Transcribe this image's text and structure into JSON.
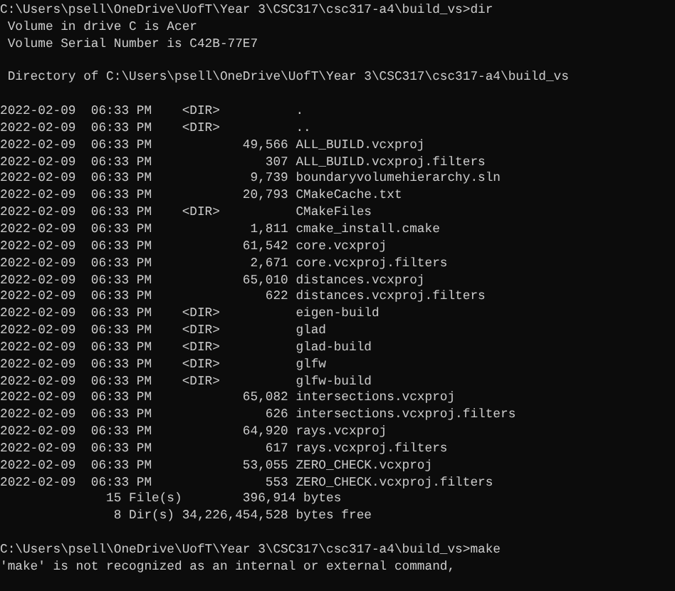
{
  "prompt_dir": "C:\\Users\\psell\\OneDrive\\UofT\\Year 3\\CSC317\\csc317-a4\\build_vs>dir",
  "volume_info": [
    " Volume in drive C is Acer",
    " Volume Serial Number is C42B-77E7"
  ],
  "directory_header": " Directory of C:\\Users\\psell\\OneDrive\\UofT\\Year 3\\CSC317\\csc317-a4\\build_vs",
  "entries": [
    {
      "date": "2022-02-09",
      "time": "06:33 PM",
      "kind": "dir",
      "size": "<DIR>",
      "name": "."
    },
    {
      "date": "2022-02-09",
      "time": "06:33 PM",
      "kind": "dir",
      "size": "<DIR>",
      "name": ".."
    },
    {
      "date": "2022-02-09",
      "time": "06:33 PM",
      "kind": "file",
      "size": "49,566",
      "name": "ALL_BUILD.vcxproj"
    },
    {
      "date": "2022-02-09",
      "time": "06:33 PM",
      "kind": "file",
      "size": "307",
      "name": "ALL_BUILD.vcxproj.filters"
    },
    {
      "date": "2022-02-09",
      "time": "06:33 PM",
      "kind": "file",
      "size": "9,739",
      "name": "boundaryvolumehierarchy.sln"
    },
    {
      "date": "2022-02-09",
      "time": "06:33 PM",
      "kind": "file",
      "size": "20,793",
      "name": "CMakeCache.txt"
    },
    {
      "date": "2022-02-09",
      "time": "06:33 PM",
      "kind": "dir",
      "size": "<DIR>",
      "name": "CMakeFiles"
    },
    {
      "date": "2022-02-09",
      "time": "06:33 PM",
      "kind": "file",
      "size": "1,811",
      "name": "cmake_install.cmake"
    },
    {
      "date": "2022-02-09",
      "time": "06:33 PM",
      "kind": "file",
      "size": "61,542",
      "name": "core.vcxproj"
    },
    {
      "date": "2022-02-09",
      "time": "06:33 PM",
      "kind": "file",
      "size": "2,671",
      "name": "core.vcxproj.filters"
    },
    {
      "date": "2022-02-09",
      "time": "06:33 PM",
      "kind": "file",
      "size": "65,010",
      "name": "distances.vcxproj"
    },
    {
      "date": "2022-02-09",
      "time": "06:33 PM",
      "kind": "file",
      "size": "622",
      "name": "distances.vcxproj.filters"
    },
    {
      "date": "2022-02-09",
      "time": "06:33 PM",
      "kind": "dir",
      "size": "<DIR>",
      "name": "eigen-build"
    },
    {
      "date": "2022-02-09",
      "time": "06:33 PM",
      "kind": "dir",
      "size": "<DIR>",
      "name": "glad"
    },
    {
      "date": "2022-02-09",
      "time": "06:33 PM",
      "kind": "dir",
      "size": "<DIR>",
      "name": "glad-build"
    },
    {
      "date": "2022-02-09",
      "time": "06:33 PM",
      "kind": "dir",
      "size": "<DIR>",
      "name": "glfw"
    },
    {
      "date": "2022-02-09",
      "time": "06:33 PM",
      "kind": "dir",
      "size": "<DIR>",
      "name": "glfw-build"
    },
    {
      "date": "2022-02-09",
      "time": "06:33 PM",
      "kind": "file",
      "size": "65,082",
      "name": "intersections.vcxproj"
    },
    {
      "date": "2022-02-09",
      "time": "06:33 PM",
      "kind": "file",
      "size": "626",
      "name": "intersections.vcxproj.filters"
    },
    {
      "date": "2022-02-09",
      "time": "06:33 PM",
      "kind": "file",
      "size": "64,920",
      "name": "rays.vcxproj"
    },
    {
      "date": "2022-02-09",
      "time": "06:33 PM",
      "kind": "file",
      "size": "617",
      "name": "rays.vcxproj.filters"
    },
    {
      "date": "2022-02-09",
      "time": "06:33 PM",
      "kind": "file",
      "size": "53,055",
      "name": "ZERO_CHECK.vcxproj"
    },
    {
      "date": "2022-02-09",
      "time": "06:33 PM",
      "kind": "file",
      "size": "553",
      "name": "ZERO_CHECK.vcxproj.filters"
    }
  ],
  "summary": [
    {
      "count": "15",
      "label": "File(s)",
      "bytes": "396,914",
      "suffix": "bytes"
    },
    {
      "count": "8",
      "label": "Dir(s)",
      "bytes": "34,226,454,528",
      "suffix": "bytes free"
    }
  ],
  "prompt_make": "C:\\Users\\psell\\OneDrive\\UofT\\Year 3\\CSC317\\csc317-a4\\build_vs>make",
  "error": "'make' is not recognized as an internal or external command,"
}
